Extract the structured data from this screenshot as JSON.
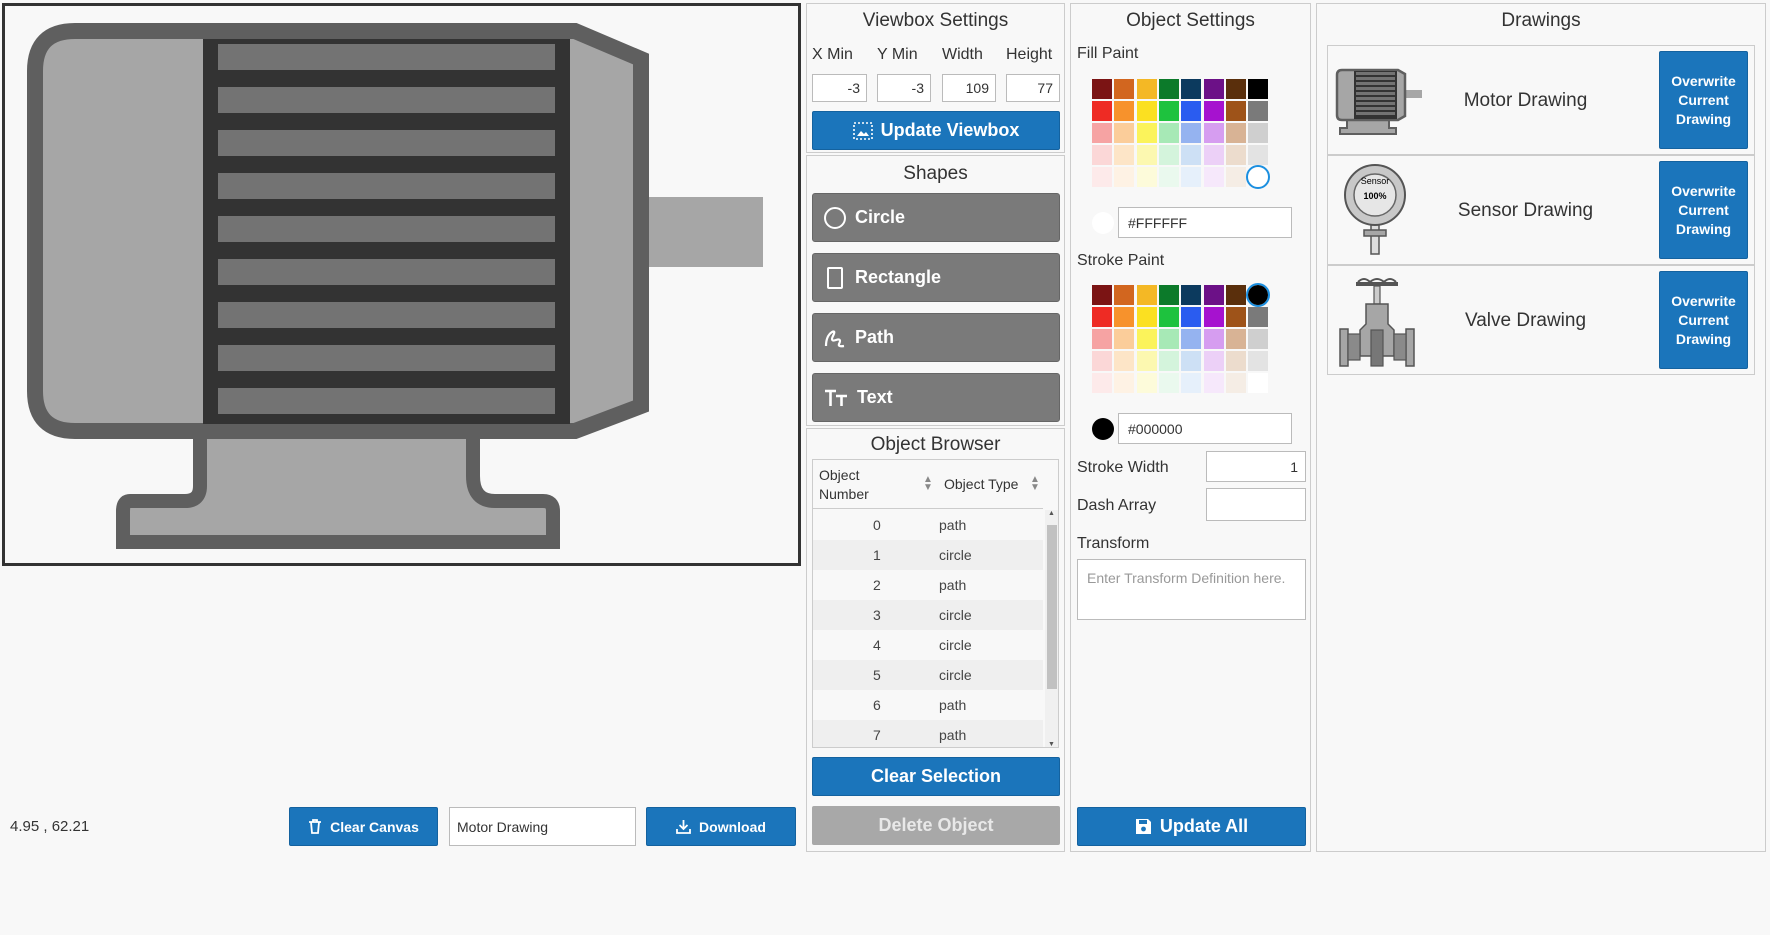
{
  "canvas": {
    "coordinate_readout": "4.95 , 62.21"
  },
  "toolbar": {
    "clear_canvas_label": "Clear Canvas",
    "drawing_name_value": "Motor Drawing",
    "download_label": "Download"
  },
  "viewbox": {
    "title": "Viewbox Settings",
    "xmin_label": "X Min",
    "ymin_label": "Y Min",
    "width_label": "Width",
    "height_label": "Height",
    "xmin": "-3",
    "ymin": "-3",
    "width": "109",
    "height": "77",
    "update_label": "Update Viewbox"
  },
  "shapes": {
    "title": "Shapes",
    "circle": "Circle",
    "rectangle": "Rectangle",
    "path": "Path",
    "text": "Text"
  },
  "object_browser": {
    "title": "Object Browser",
    "col_number": "Object Number",
    "col_type": "Object Type",
    "rows": [
      {
        "num": "0",
        "type": "path"
      },
      {
        "num": "1",
        "type": "circle"
      },
      {
        "num": "2",
        "type": "path"
      },
      {
        "num": "3",
        "type": "circle"
      },
      {
        "num": "4",
        "type": "circle"
      },
      {
        "num": "5",
        "type": "circle"
      },
      {
        "num": "6",
        "type": "path"
      },
      {
        "num": "7",
        "type": "path"
      }
    ],
    "clear_selection_label": "Clear Selection",
    "delete_label": "Delete Object"
  },
  "object_settings": {
    "title": "Object Settings",
    "fill_label": "Fill Paint",
    "fill_value": "#FFFFFF",
    "stroke_label": "Stroke Paint",
    "stroke_value": "#000000",
    "stroke_width_label": "Stroke Width",
    "stroke_width_value": "1",
    "dash_label": "Dash Array",
    "dash_value": "",
    "transform_label": "Transform",
    "transform_placeholder": "Enter Transform Definition here.",
    "update_all_label": "Update All"
  },
  "palette": {
    "rows": [
      [
        "#7b1414",
        "#d2661f",
        "#f4b825",
        "#0c7a2a",
        "#0c3a5e",
        "#6c1187",
        "#5a2f0c",
        "#000000"
      ],
      [
        "#ee2b24",
        "#f7922c",
        "#fbe021",
        "#1ec23e",
        "#2a5cf0",
        "#a612cf",
        "#9e5319",
        "#7a7a7a"
      ],
      [
        "#f6a3a3",
        "#fbcd9a",
        "#fbf35b",
        "#a7e9b6",
        "#95b3f0",
        "#d69df0",
        "#d8b395",
        "#cfcfcf"
      ],
      [
        "#fbd7d7",
        "#fde5c7",
        "#fcf8b0",
        "#d4f4dc",
        "#cde0f5",
        "#ecd0f7",
        "#ecdccd",
        "#e3e3e3"
      ],
      [
        "#fdeaea",
        "#fef2e4",
        "#fdfbda",
        "#eaf9ee",
        "#e6f0fb",
        "#f6e8fb",
        "#f5ede5",
        "#ffffff"
      ]
    ]
  },
  "drawings": {
    "title": "Drawings",
    "items": [
      {
        "name": "Motor Drawing",
        "button": "Overwrite Current Drawing"
      },
      {
        "name": "Sensor Drawing",
        "button": "Overwrite Current Drawing"
      },
      {
        "name": "Valve Drawing",
        "button": "Overwrite Current Drawing"
      }
    ],
    "sensor_text_top": "Sensor",
    "sensor_text_value": "100%"
  }
}
